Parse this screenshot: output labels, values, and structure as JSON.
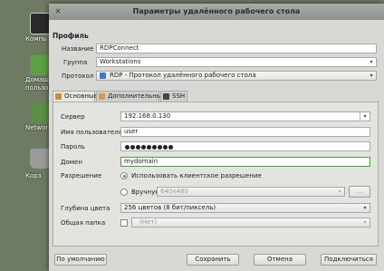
{
  "desktop": {
    "icons": [
      {
        "label": "Компь",
        "icon": "monitor-icon"
      },
      {
        "label": "Домашняя\nпользоват",
        "icon": "home-folder-icon"
      },
      {
        "label": "Network S",
        "icon": "network-icon"
      },
      {
        "label": "Корз",
        "icon": "trash-icon"
      }
    ]
  },
  "window": {
    "title": "Параметры удалённого рабочего стола",
    "close_glyph": "✕"
  },
  "profile": {
    "section_label": "Профиль",
    "name_label": "Название",
    "name_value": "RDPConnect",
    "group_label": "Группа",
    "group_value": "Workstations",
    "protocol_label": "Протокол",
    "protocol_value": "RDP - Протокол удалённого рабочего стола"
  },
  "tabs": [
    {
      "label": "Основные",
      "icon": "settings-tab-icon"
    },
    {
      "label": "Дополнительные",
      "icon": "advanced-tab-icon"
    },
    {
      "label": "SSH",
      "icon": "ssh-tab-icon"
    }
  ],
  "basic": {
    "server_label": "Сервер",
    "server_value": "192.168.0.130",
    "username_label": "Имя пользователя",
    "username_value": "user",
    "password_label": "Пароль",
    "password_dots": 9,
    "domain_label": "Домен",
    "domain_value": "mydomain",
    "resolution_label": "Разрешение",
    "resolution_client": "Использовать клиентское разрешение",
    "resolution_manual": "Вручную",
    "resolution_manual_value": "640x480",
    "resolution_more": "...",
    "color_depth_label": "Глубина цвета",
    "color_depth_value": "256 цветов (8 бит/пиксель)",
    "shared_folder_label": "Общая папка",
    "shared_folder_value": "(Нет)"
  },
  "buttons": {
    "default": "По умолчанию",
    "save": "Сохранить",
    "cancel": "Отмена",
    "connect": "Подключиться"
  },
  "colors": {
    "accent_green": "#4c9b3c",
    "desktop_bg": "#6f7a63"
  }
}
